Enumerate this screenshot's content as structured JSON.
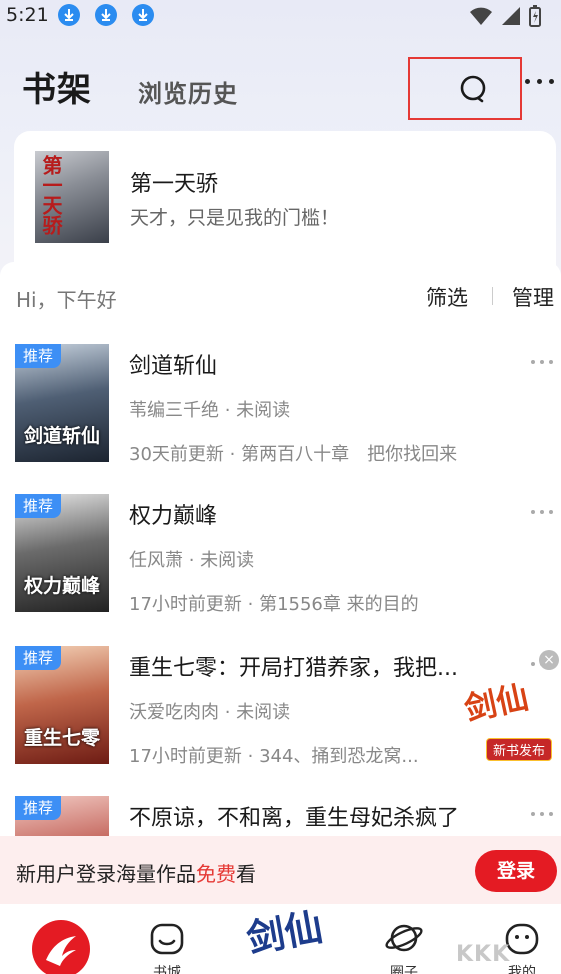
{
  "status_bar": {
    "time": "5:21",
    "download_icons": [
      "download-icon",
      "download-icon",
      "download-icon"
    ],
    "system_icons": [
      "wifi-icon",
      "signal-icon",
      "battery-icon"
    ]
  },
  "header": {
    "title": "书架",
    "tab": "浏览历史"
  },
  "recommendation": {
    "cover_text": "第一天骄",
    "title": "第一天骄",
    "subtitle": "天才，只是见我的门槛！"
  },
  "shelf": {
    "greeting": "Hi，下午好",
    "filter_label": "筛选",
    "manage_label": "管理",
    "books": [
      {
        "tag": "推荐",
        "cover_word": "剑道斩仙",
        "title": "剑道斩仙",
        "meta": "苇编三千绝 · 未阅读",
        "update": "30天前更新 · 第两百八十章　把你找回来"
      },
      {
        "tag": "推荐",
        "cover_word": "权力巅峰",
        "title": "权力巅峰",
        "meta": "任风萧 · 未阅读",
        "update": "17小时前更新 · 第1556章 来的目的"
      },
      {
        "tag": "推荐",
        "cover_word": "重生七零",
        "title": "重生七零：开局打猎养家，我把...",
        "meta": "沃爱吃肉肉 · 未阅读",
        "update": "17小时前更新 · 344、捅到恐龙窝..."
      },
      {
        "tag": "推荐",
        "cover_word": "",
        "title": "不原谅，不和离，重生母妃杀疯了",
        "meta": "",
        "update": ""
      }
    ]
  },
  "float_ad": {
    "brand": "剑仙",
    "badge": "新书发布"
  },
  "login_banner": {
    "text_before": "新用户登录海量作品",
    "text_highlight": "免费",
    "text_after": "看",
    "button": "登录"
  },
  "bottom_nav": {
    "items": [
      {
        "label": "",
        "icon": "app-logo-icon"
      },
      {
        "label": "书城",
        "icon": "bookstore-icon"
      },
      {
        "label": "",
        "icon": "promo-center-icon"
      },
      {
        "label": "圈子",
        "icon": "planet-icon"
      },
      {
        "label": "我的",
        "icon": "profile-icon"
      }
    ],
    "center_brand": "剑仙"
  },
  "watermark": "KKK"
}
